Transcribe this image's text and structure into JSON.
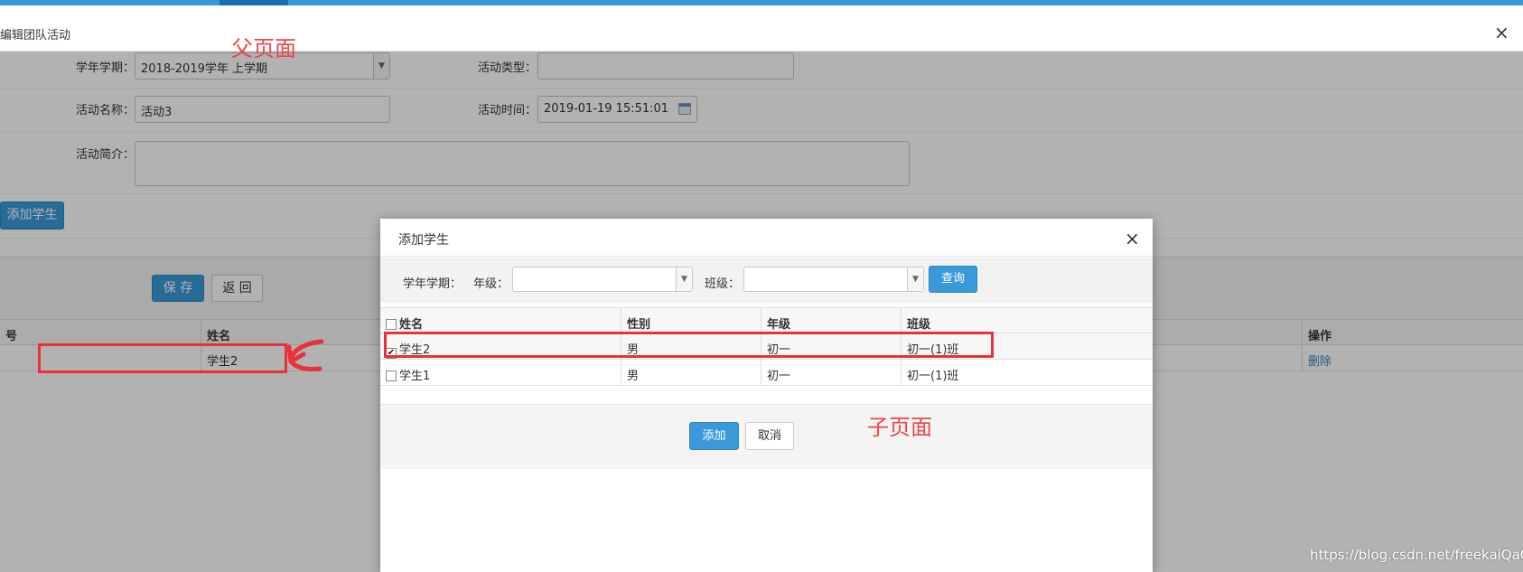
{
  "parent": {
    "title": "编辑团队活动",
    "close_glyph": "×",
    "fields": {
      "term_label": "学年学期：",
      "term_value": "2018-2019学年 上学期",
      "type_label": "活动类型：",
      "type_value": "",
      "name_label": "活动名称：",
      "name_value": "活动3",
      "time_label": "活动时间：",
      "time_value": "2019-01-19 15:51:01",
      "intro_label": "活动简介：",
      "intro_value": ""
    },
    "add_student_label": "添加学生",
    "save_label": "保 存",
    "back_label": "返 回",
    "table": {
      "headers": [
        "号",
        "姓名",
        "操作"
      ],
      "rows": [
        {
          "no": "",
          "name": "学生2",
          "action": "删除"
        }
      ]
    }
  },
  "modal": {
    "title": "添加学生",
    "close_glyph": "×",
    "filter": {
      "term_label": "学年学期：",
      "grade_label": "年级：",
      "grade_value": "",
      "class_label": "班级：",
      "class_value": "",
      "query_label": "查询"
    },
    "table": {
      "headers": [
        "姓名",
        "性别",
        "年级",
        "班级"
      ],
      "rows": [
        {
          "checked": true,
          "name": "学生2",
          "gender": "男",
          "grade": "初一",
          "class": "初一(1)班"
        },
        {
          "checked": false,
          "name": "学生1",
          "gender": "男",
          "grade": "初一",
          "class": "初一(1)班"
        }
      ]
    },
    "add_label": "添加",
    "cancel_label": "取消"
  },
  "annotations": {
    "parent_label": "父页面",
    "child_label": "子页面",
    "highlight_color": "#e8313a"
  },
  "watermark": "https://blog.csdn.net/freekaiQaQ"
}
